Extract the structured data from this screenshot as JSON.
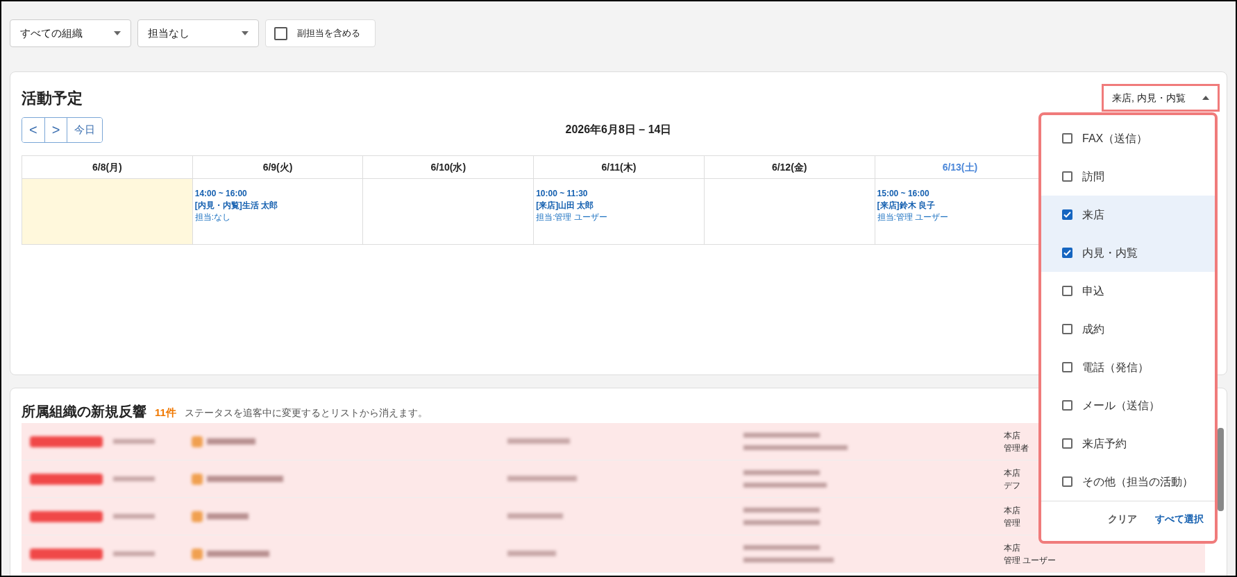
{
  "filters": {
    "organization": "すべての組織",
    "assignee": "担当なし",
    "include_sub": {
      "label": "副担当を含める",
      "checked": false
    }
  },
  "schedule": {
    "title": "活動予定",
    "nav": {
      "prev": "<",
      "next": ">",
      "today": "今日"
    },
    "range": "2026年6月8日 – 14日",
    "type_filter": {
      "value": "来店, 内見・内覧",
      "expanded": true
    },
    "days": [
      {
        "label": "6/8(月)",
        "kind": "weekday",
        "today": true
      },
      {
        "label": "6/9(火)",
        "kind": "weekday",
        "today": false,
        "events": [
          {
            "time": "14:00 ~ 16:00",
            "title": "[内見・内覧]生活 太郎",
            "assignee": "担当:なし"
          }
        ]
      },
      {
        "label": "6/10(水)",
        "kind": "weekday",
        "today": false
      },
      {
        "label": "6/11(木)",
        "kind": "weekday",
        "today": false,
        "events": [
          {
            "time": "10:00 ~ 11:30",
            "title": "[来店]山田 太郎",
            "assignee": "担当:管理 ユーザー"
          }
        ]
      },
      {
        "label": "6/12(金)",
        "kind": "weekday",
        "today": false
      },
      {
        "label": "6/13(土)",
        "kind": "saturday",
        "today": false,
        "events": [
          {
            "time": "15:00 ~ 16:00",
            "title": "[来店]鈴木 良子",
            "assignee": "担当:管理 ユーザー"
          }
        ]
      }
    ]
  },
  "type_menu": {
    "options": [
      {
        "label": "FAX（送信）",
        "checked": false
      },
      {
        "label": "訪問",
        "checked": false
      },
      {
        "label": "来店",
        "checked": true
      },
      {
        "label": "内見・内覧",
        "checked": true
      },
      {
        "label": "申込",
        "checked": false
      },
      {
        "label": "成約",
        "checked": false
      },
      {
        "label": "電話（発信）",
        "checked": false
      },
      {
        "label": "メール（送信）",
        "checked": false
      },
      {
        "label": "来店予約",
        "checked": false
      },
      {
        "label": "その他（担当の活動）",
        "checked": false
      }
    ],
    "clear": "クリア",
    "select_all": "すべて選択"
  },
  "responses": {
    "title": "所属組織の新規反響",
    "count": "11件",
    "note": "ステータスを追客中に変更するとリストから消えます。",
    "rows": [
      {
        "office": "本店",
        "manager": "管理者"
      },
      {
        "office": "本店",
        "manager": "デフ"
      },
      {
        "office": "本店",
        "manager": "管理"
      },
      {
        "office": "本店",
        "manager": "管理 ユーザー"
      }
    ]
  }
}
